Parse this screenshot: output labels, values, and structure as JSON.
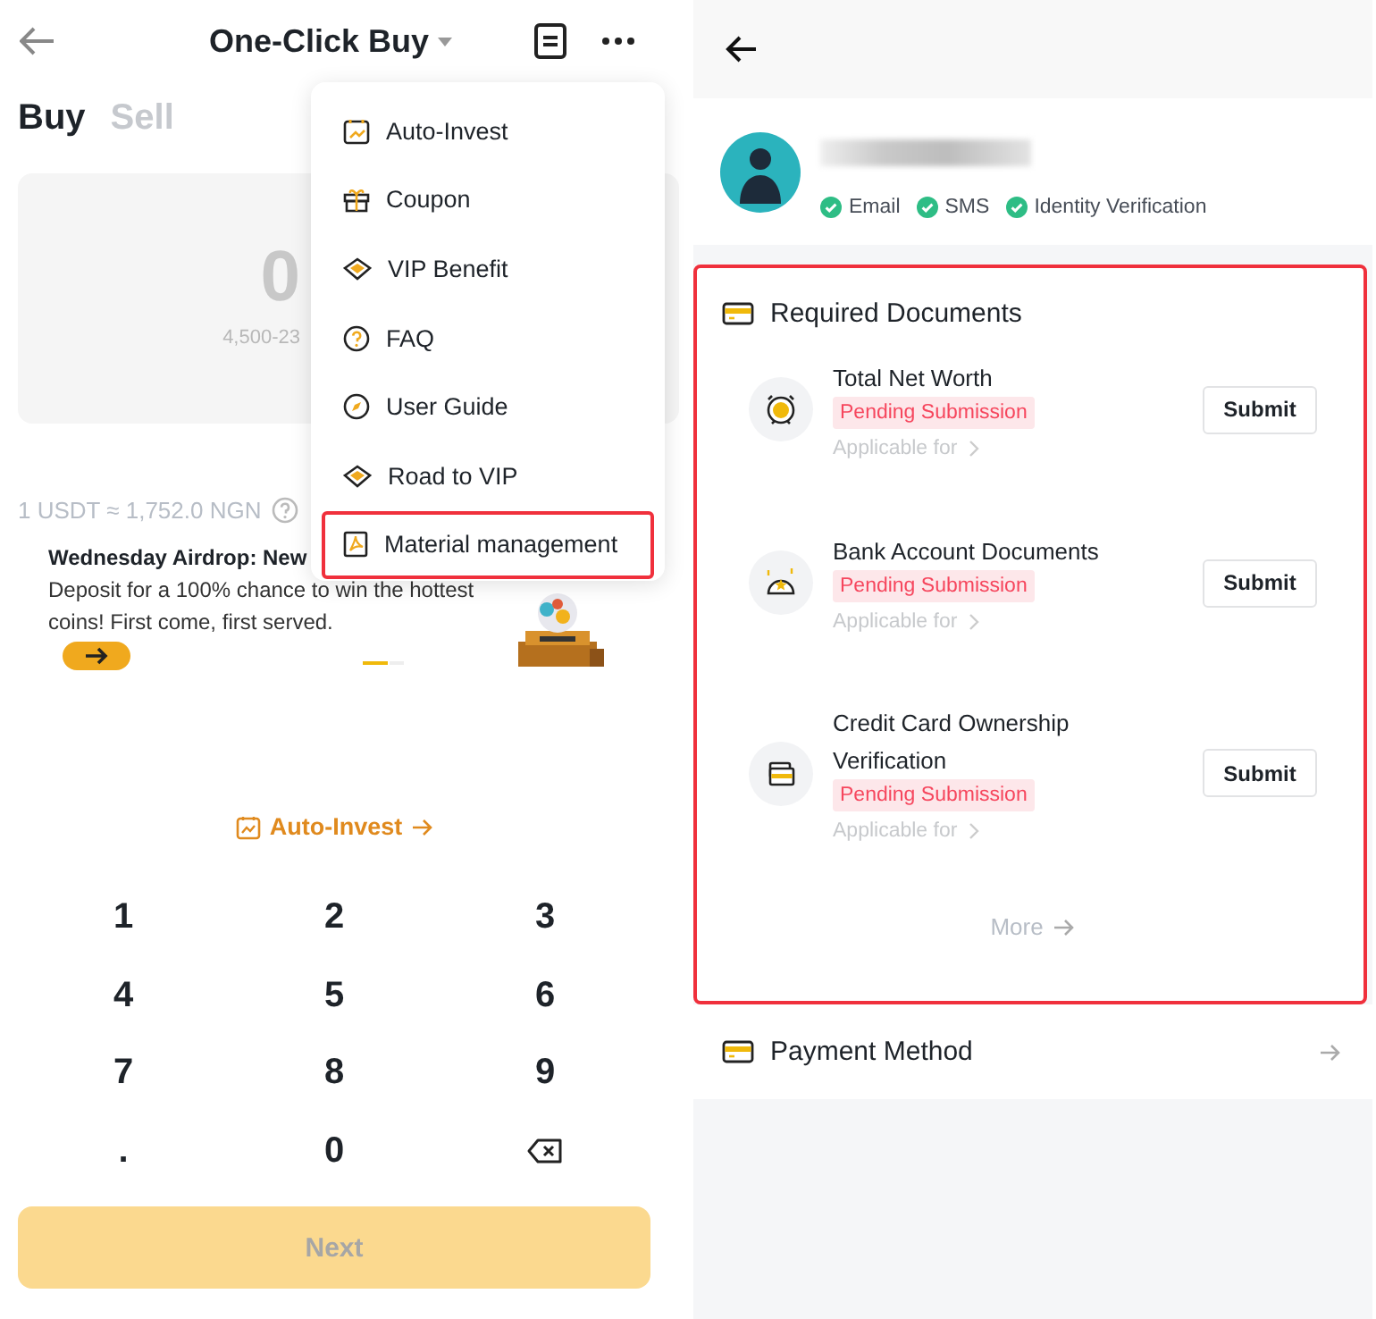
{
  "left": {
    "header": {
      "title": "One-Click Buy"
    },
    "tabs": [
      {
        "label": "Buy",
        "selected": true
      },
      {
        "label": "Sell",
        "selected": false
      }
    ],
    "amount": {
      "value": "0",
      "range": "4,500-23"
    },
    "rate": "1 USDT ≈ 1,752.0 NGN",
    "banner": {
      "title": "Wednesday Airdrop: New",
      "text": "Deposit for a 100% chance to win the hottest coins! First come, first served.",
      "pages": [
        {
          "selected": true
        },
        {
          "selected": false
        }
      ]
    },
    "auto_invest_link": "Auto-Invest",
    "keypad": [
      {
        "kind": "key",
        "label": "1"
      },
      {
        "kind": "key",
        "label": "2"
      },
      {
        "kind": "key",
        "label": "3"
      },
      {
        "kind": "key",
        "label": "4"
      },
      {
        "kind": "key",
        "label": "5"
      },
      {
        "kind": "key",
        "label": "6"
      },
      {
        "kind": "key",
        "label": "7"
      },
      {
        "kind": "key",
        "label": "8"
      },
      {
        "kind": "key",
        "label": "9"
      },
      {
        "kind": "key",
        "label": "."
      },
      {
        "kind": "key",
        "label": "0"
      },
      {
        "kind": "backspace"
      }
    ],
    "next_button": {
      "label": "Next",
      "disabled": true
    },
    "menu": {
      "items": [
        {
          "label": "Auto-Invest",
          "highlighted": false
        },
        {
          "label": "Coupon",
          "highlighted": false
        },
        {
          "label": "VIP Benefit",
          "highlighted": false
        },
        {
          "label": "FAQ",
          "highlighted": false
        },
        {
          "label": "User Guide",
          "highlighted": false
        },
        {
          "label": "Road to VIP",
          "highlighted": false
        },
        {
          "label": "Material management",
          "highlighted": true
        }
      ]
    }
  },
  "right": {
    "profile": {
      "verifications": [
        {
          "label": "Email",
          "verified": true
        },
        {
          "label": "SMS",
          "verified": true
        },
        {
          "label": "Identity Verification",
          "verified": true
        }
      ]
    },
    "documents": {
      "title": "Required Documents",
      "highlighted": true,
      "items": [
        {
          "title": "Total Net Worth",
          "status": "Pending Submission",
          "applicable": "Applicable for",
          "button": "Submit"
        },
        {
          "title": "Bank Account Documents",
          "status": "Pending Submission",
          "applicable": "Applicable for",
          "button": "Submit"
        },
        {
          "title": "Credit Card Ownership Verification",
          "status": "Pending Submission",
          "applicable": "Applicable for",
          "button": "Submit"
        }
      ],
      "more": "More"
    },
    "payment_method": {
      "label": "Payment Method"
    }
  }
}
